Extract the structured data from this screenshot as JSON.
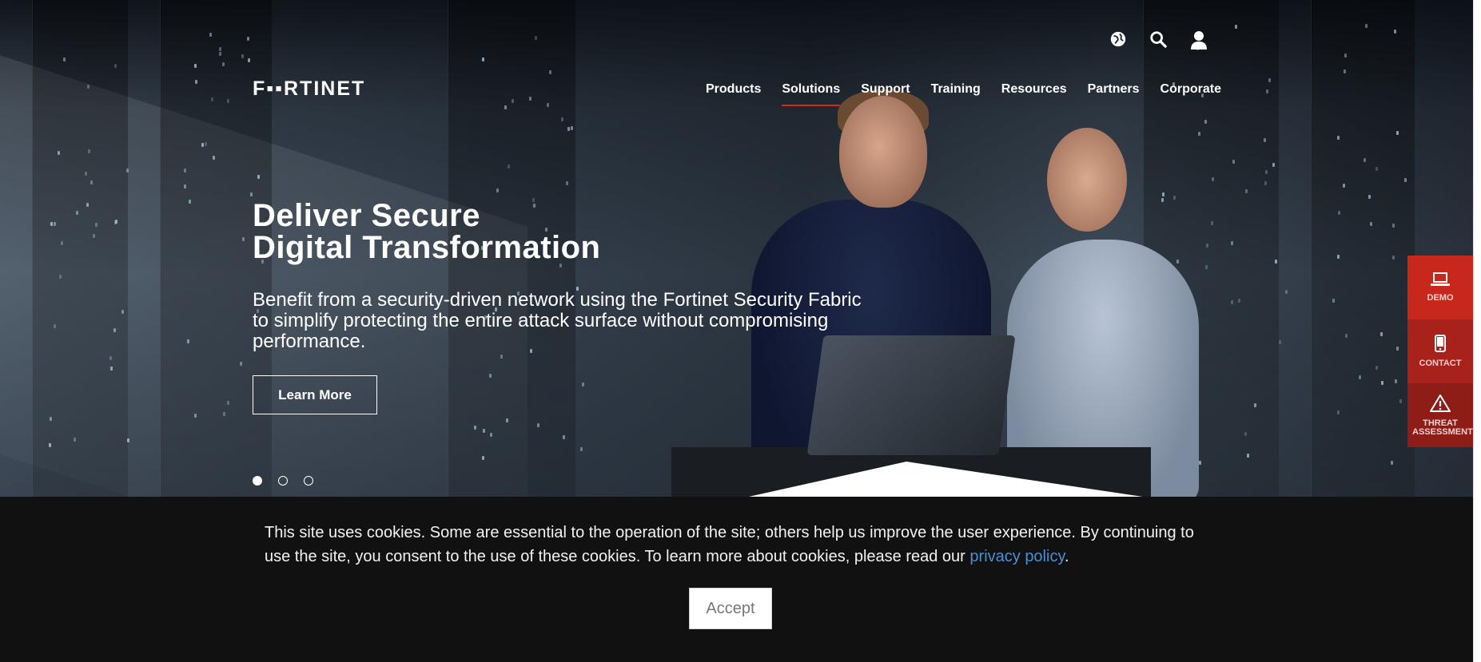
{
  "header": {
    "logo_text": "F▪▪RTINET",
    "utility_icons": [
      "globe-icon",
      "search-icon",
      "user-icon"
    ],
    "nav": [
      {
        "label": "Products",
        "active": false
      },
      {
        "label": "Solutions",
        "active": true
      },
      {
        "label": "Support",
        "active": false
      },
      {
        "label": "Training",
        "active": false
      },
      {
        "label": "Resources",
        "active": false
      },
      {
        "label": "Partners",
        "active": false
      },
      {
        "label": "Corporate",
        "active": false
      }
    ]
  },
  "hero": {
    "headline_line1": "Deliver Secure",
    "headline_line2": "Digital Transformation",
    "subtext": "Benefit from a security-driven network using the Fortinet Security Fabric to simplify protecting the entire attack surface without compromising performance.",
    "cta_label": "Learn More",
    "slides": 3,
    "active_slide": 1
  },
  "side_tabs": [
    {
      "label": "DEMO",
      "icon": "laptop-icon"
    },
    {
      "label": "CONTACT",
      "icon": "mobile-icon"
    },
    {
      "label": "THREAT ASSESSMENT",
      "icon": "warning-icon"
    }
  ],
  "cookie": {
    "text_before": "This site uses cookies. Some are essential to the operation of the site; others help us improve the user experience. By continuing to use the site, you consent to the use of these cookies. To learn more about cookies, please read our ",
    "link_text": "privacy policy",
    "text_after": ".",
    "accept_label": "Accept"
  },
  "colors": {
    "brand_red": "#da291c",
    "cookie_bg": "#111111",
    "link_blue": "#4a8fd6"
  }
}
